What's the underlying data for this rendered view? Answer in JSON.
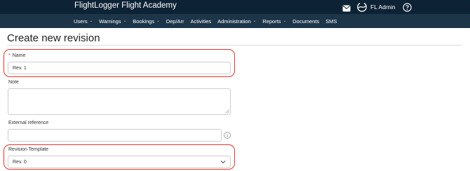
{
  "header": {
    "brand": "FlightLogger Flight Academy",
    "user_name": "FL Admin"
  },
  "nav": {
    "items": [
      {
        "label": "Users",
        "has_caret": true
      },
      {
        "label": "Warnings",
        "has_caret": true
      },
      {
        "label": "Bookings",
        "has_caret": true
      },
      {
        "label": "Dep/Arr",
        "has_caret": false
      },
      {
        "label": "Activities",
        "has_caret": false
      },
      {
        "label": "Administration",
        "has_caret": true
      },
      {
        "label": "Reports",
        "has_caret": true
      },
      {
        "label": "Documents",
        "has_caret": false
      },
      {
        "label": "SMS",
        "has_caret": false
      }
    ],
    "caret": "⌄"
  },
  "page": {
    "title": "Create new revision"
  },
  "form": {
    "name": {
      "required_mark": "*",
      "label": "Name",
      "value": "Rev. 1"
    },
    "note": {
      "label": "Note",
      "value": ""
    },
    "external_reference": {
      "label": "External reference",
      "value": ""
    },
    "revision_template": {
      "label": "Revision Template",
      "selected": "Rev. 0"
    }
  },
  "colors": {
    "topbar": "#0d2235",
    "navbar": "#1c3549",
    "highlight": "#e0362b"
  },
  "icons": {
    "mail": "mail-icon",
    "logo": "flightlogger-logo-icon",
    "help": "help-icon",
    "info": "info-icon",
    "select_arrow": "chevron-down-icon"
  }
}
